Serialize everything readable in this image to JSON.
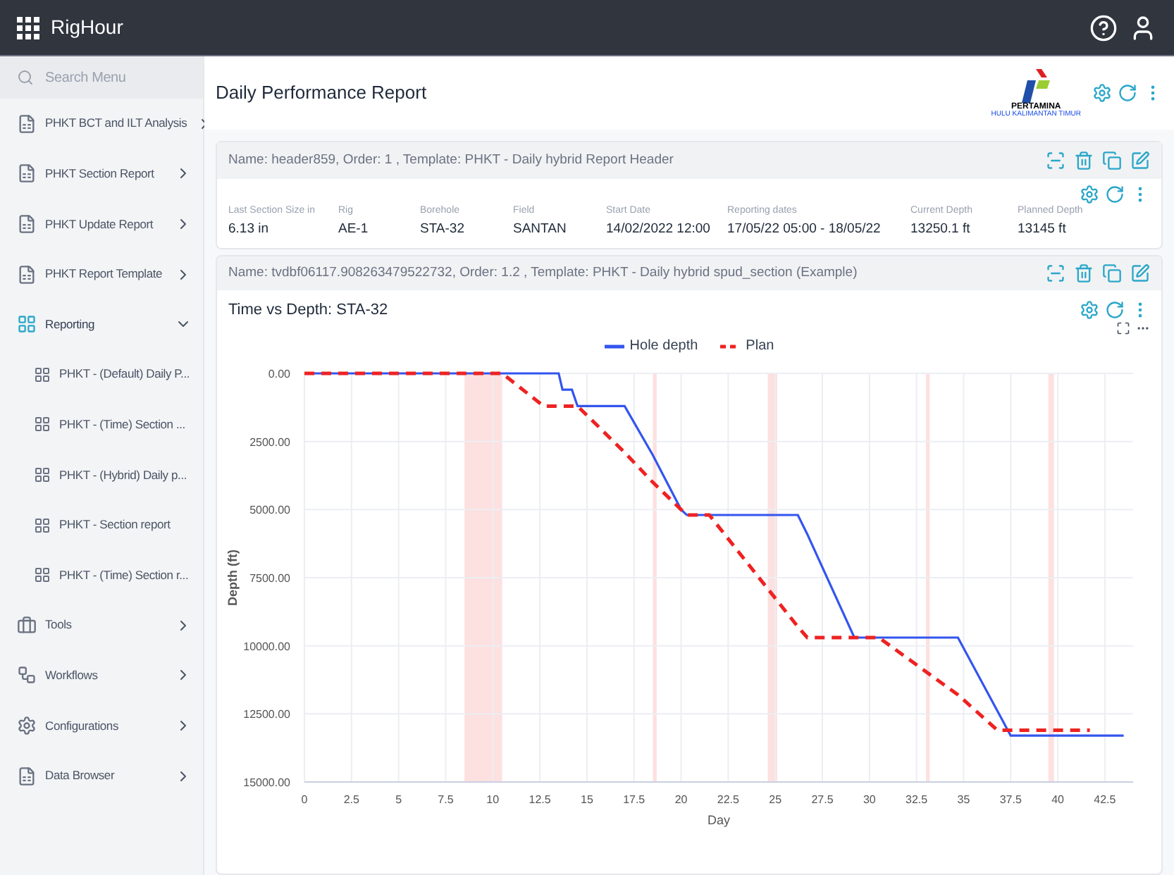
{
  "app_bar": {
    "title": "RigHour"
  },
  "sidebar": {
    "search": {
      "placeholder": "Search Menu"
    },
    "items": [
      {
        "label": "PHKT BCT and ILT Analysis",
        "kind": "report",
        "expanded": false
      },
      {
        "label": "PHKT Section Report",
        "kind": "report",
        "expanded": false
      },
      {
        "label": "PHKT Update Report",
        "kind": "report",
        "expanded": false
      },
      {
        "label": "PHKT Report Template",
        "kind": "report",
        "expanded": false
      },
      {
        "label": "Reporting",
        "kind": "grid",
        "expanded": true,
        "children": [
          {
            "label": "PHKT - (Default) Daily P..."
          },
          {
            "label": "PHKT - (Time) Section ..."
          },
          {
            "label": "PHKT - (Hybrid) Daily p..."
          },
          {
            "label": "PHKT - Section report"
          },
          {
            "label": "PHKT - (Time) Section r..."
          }
        ]
      },
      {
        "label": "Tools",
        "kind": "tools",
        "expanded": false
      },
      {
        "label": "Workflows",
        "kind": "workflow",
        "expanded": false
      },
      {
        "label": "Configurations",
        "kind": "gear",
        "expanded": false
      },
      {
        "label": "Data Browser",
        "kind": "report",
        "expanded": false
      }
    ]
  },
  "page": {
    "title": "Daily Performance Report",
    "logo": {
      "name": "PERTAMINA",
      "sub": "HULU KALIMANTAN TIMUR"
    }
  },
  "header_card": {
    "caption": "Name: header859, Order: 1 , Template: PHKT - Daily hybrid Report Header",
    "fields": [
      {
        "label": "Last Section Size in",
        "value": "6.13 in"
      },
      {
        "label": "Rig",
        "value": "AE-1"
      },
      {
        "label": "Borehole",
        "value": "STA-32"
      },
      {
        "label": "Field",
        "value": "SANTAN"
      },
      {
        "label": "Start Date",
        "value": "14/02/2022 12:00"
      },
      {
        "label": "Reporting dates",
        "value": "17/05/22 05:00 - 18/05/22"
      },
      {
        "label": "Current Depth",
        "value": "13250.1 ft"
      },
      {
        "label": "Planned Depth",
        "value": "13145 ft"
      }
    ]
  },
  "chart_card": {
    "caption": "Name: tvdbf06117.908263479522732, Order: 1.2 , Template: PHKT - Daily hybrid spud_section (Example)",
    "title": "Time vs Depth: STA-32",
    "chart_data": {
      "type": "line",
      "xlabel": "Day",
      "ylabel": "Depth (ft)",
      "x": [
        0,
        8.5,
        10.5,
        12.7,
        13.5,
        13.7,
        14.2,
        14.5,
        17,
        18.5,
        20,
        20.3,
        21.5,
        26.2,
        26.7,
        29.2,
        30.5,
        34.7,
        36.8,
        37.5,
        41.7,
        43.5
      ],
      "series": [
        {
          "name": "Hole depth",
          "color": "#3355ee",
          "line_style": "solid",
          "values": [
            0,
            0,
            0,
            0,
            0,
            600,
            600,
            1200,
            1200,
            3000,
            5000,
            5200,
            5200,
            5200,
            5900,
            9700,
            9700,
            9700,
            12400,
            13300,
            13300,
            13300
          ]
        },
        {
          "name": "Plan",
          "color": "#ee2222",
          "line_style": "dashed",
          "values": [
            0,
            0,
            0,
            1200,
            1200,
            1200,
            1200,
            1200,
            2900,
            4000,
            5000,
            5200,
            5200,
            9300,
            9700,
            9700,
            9700,
            11800,
            13100,
            13100,
            13100,
            null
          ]
        }
      ],
      "grid": true,
      "legend": "top",
      "xlim": [
        0,
        44
      ],
      "ylim": [
        15000,
        0
      ],
      "xticks": [
        {
          "value": 0,
          "label": "0"
        },
        {
          "value": 2.5,
          "label": "2.5"
        },
        {
          "value": 5,
          "label": "5"
        },
        {
          "value": 7.5,
          "label": "7.5"
        },
        {
          "value": 10,
          "label": "10"
        },
        {
          "value": 12.5,
          "label": "12.5"
        },
        {
          "value": 15,
          "label": "15"
        },
        {
          "value": 17.5,
          "label": "17.5"
        },
        {
          "value": 20,
          "label": "20"
        },
        {
          "value": 22.5,
          "label": "22.5"
        },
        {
          "value": 25,
          "label": "25"
        },
        {
          "value": 27.5,
          "label": "27.5"
        },
        {
          "value": 30,
          "label": "30"
        },
        {
          "value": 32.5,
          "label": "32.5"
        },
        {
          "value": 35,
          "label": "35"
        },
        {
          "value": 37.5,
          "label": "37.5"
        },
        {
          "value": 40,
          "label": "40"
        },
        {
          "value": 42.5,
          "label": "42.5"
        }
      ],
      "yticks": [
        {
          "value": 0,
          "label": "0.00"
        },
        {
          "value": 2500,
          "label": "2500.00"
        },
        {
          "value": 5000,
          "label": "5000.00"
        },
        {
          "value": 7500,
          "label": "7500.00"
        },
        {
          "value": 10000,
          "label": "10000.00"
        },
        {
          "value": 12500,
          "label": "12500.00"
        },
        {
          "value": 15000,
          "label": "15000.00"
        }
      ],
      "bands": [
        {
          "axis": "x",
          "from": 8.5,
          "to": 10.5,
          "color": "#fde0e0"
        },
        {
          "axis": "x",
          "from": 18.5,
          "to": 18.7,
          "color": "#fde0e0"
        },
        {
          "axis": "x",
          "from": 24.6,
          "to": 25.1,
          "color": "#fde0e0"
        },
        {
          "axis": "x",
          "from": 33,
          "to": 33.2,
          "color": "#fde0e0"
        },
        {
          "axis": "x",
          "from": 39.5,
          "to": 39.8,
          "color": "#fde0e0"
        }
      ]
    }
  }
}
